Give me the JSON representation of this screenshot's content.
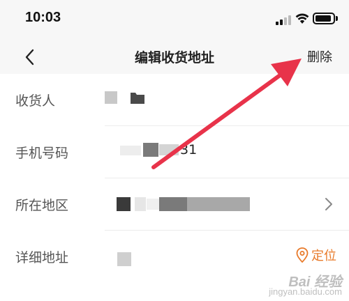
{
  "status_bar": {
    "time": "10:03",
    "icons": [
      "signal-icon",
      "wifi-icon",
      "battery-icon"
    ]
  },
  "nav": {
    "back_icon": "chevron-left-icon",
    "title": "编辑收货地址",
    "delete_label": "删除"
  },
  "form": {
    "recipient": {
      "label": "收货人"
    },
    "phone": {
      "label": "手机号码",
      "visible_suffix": "31"
    },
    "region": {
      "label": "所在地区",
      "chevron_icon": "chevron-right-icon"
    },
    "address": {
      "label": "详细地址",
      "locate_label": "定位",
      "locate_icon": "location-pin-icon"
    }
  },
  "colors": {
    "accent_orange": "#e87a2a",
    "annotation_arrow": "#e8334a",
    "nav_background": "#f7f7f7"
  },
  "annotation": {
    "arrow_icon": "red-arrow-pointing-to-delete"
  },
  "watermark": {
    "logo_text": "Bai 经验",
    "url": "jingyan.baidu.com"
  }
}
